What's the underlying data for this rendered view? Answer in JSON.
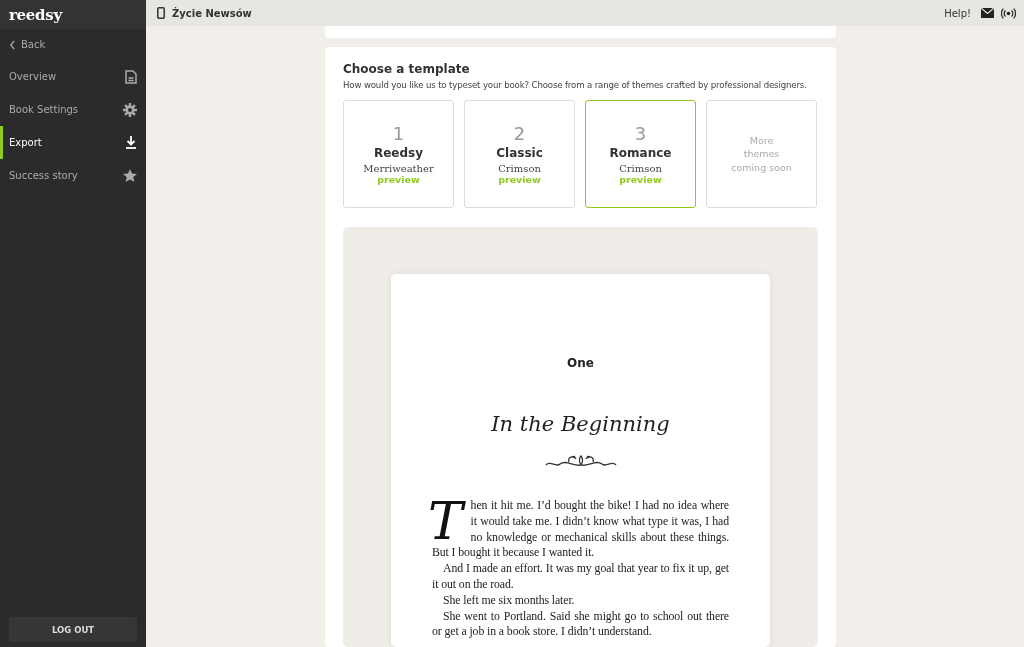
{
  "sidebar": {
    "logo": "reedsy",
    "back": "Back",
    "items": [
      {
        "label": "Overview",
        "kind": "document",
        "selected": false
      },
      {
        "label": "Book Settings",
        "kind": "gear",
        "selected": false
      },
      {
        "label": "Export",
        "kind": "download",
        "selected": true
      },
      {
        "label": "Success story",
        "kind": "star",
        "selected": false
      }
    ],
    "logout": "LOG OUT"
  },
  "topbar": {
    "book_title": "Życie Newsów",
    "help": "Help!"
  },
  "template_section": {
    "title": "Choose a template",
    "subtitle": "How would you like us to typeset your book? Choose from a range of themes crafted by professional designers.",
    "templates": [
      {
        "kind": "template",
        "number": "1",
        "name": "Reedsy",
        "font": "Merriweather",
        "link": "preview",
        "selected": false
      },
      {
        "kind": "template",
        "number": "2",
        "name": "Classic",
        "font": "Crimson",
        "link": "preview",
        "selected": false
      },
      {
        "kind": "template",
        "number": "3",
        "name": "Romance",
        "font": "Crimson",
        "link": "preview",
        "selected": true
      },
      {
        "kind": "placeholder",
        "lines": [
          "More",
          "themes",
          "coming soon"
        ]
      }
    ]
  },
  "preview": {
    "chapter_number": "One",
    "chapter_title": "In the Beginning",
    "paragraphs": [
      {
        "kind": "dropcap",
        "text": "Then it hit me. I’d bought the bike! I had no idea where it would take me. I didn’t know what type it was, I had no knowledge or mechanical skills about these things. But I bought it because I wanted it."
      },
      {
        "kind": "indent",
        "text": "And I made an effort. It was my goal that year to fix it up, get it out on the road."
      },
      {
        "kind": "indent",
        "text": "She left me six months later."
      },
      {
        "kind": "indent",
        "text": "She went to Portland. Said she might go to school out there or get a job in a book store. I didn’t understand."
      }
    ]
  }
}
